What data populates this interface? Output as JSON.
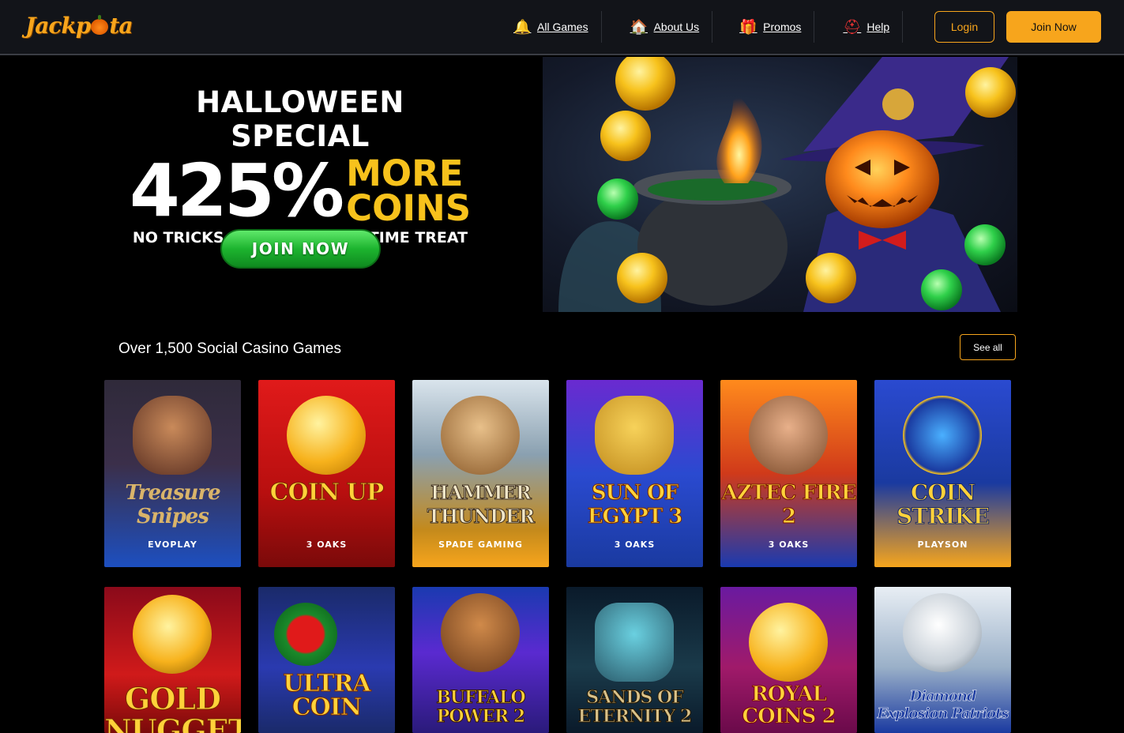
{
  "header": {
    "logo": "Jackpota",
    "nav": [
      {
        "label": "All Games",
        "icon": "bell-icon"
      },
      {
        "label": "About Us",
        "icon": "home-icon"
      },
      {
        "label": "Promos",
        "icon": "gift-icon"
      },
      {
        "label": "Help",
        "icon": "lifebuoy-icon"
      }
    ],
    "login": "Login",
    "join": "Join Now"
  },
  "hero": {
    "title": "HALLOWEEN SPECIAL",
    "percent": "425%",
    "more": "MORE",
    "coins": "COINS",
    "subtitle": "NO TRICKS, JUST A LIMITED-TIME TREAT",
    "button": "JOIN NOW"
  },
  "games": {
    "title": "Over 1,500 Social Casino Games",
    "see_all": "See all",
    "row1": [
      {
        "name": "Treasure Snipes",
        "provider": "EVOPLAY"
      },
      {
        "name": "COIN UP",
        "provider": "3 OAKS"
      },
      {
        "name": "HAMMER THUNDER",
        "provider": "SPADE GAMING"
      },
      {
        "name": "SUN OF EGYPT 3",
        "provider": "3 OAKS"
      },
      {
        "name": "AZTEC FIRE 2",
        "provider": "3 OAKS"
      },
      {
        "name": "COIN STRIKE",
        "provider": "PLAYSON"
      }
    ],
    "row2": [
      {
        "name": "GOLD NUGGETS"
      },
      {
        "name": "ULTRA COIN"
      },
      {
        "name": "BUFFALO POWER 2"
      },
      {
        "name": "SANDS OF ETERNITY 2"
      },
      {
        "name": "ROYAL COINS 2"
      },
      {
        "name": "Diamond Explosion Patriots"
      }
    ]
  }
}
